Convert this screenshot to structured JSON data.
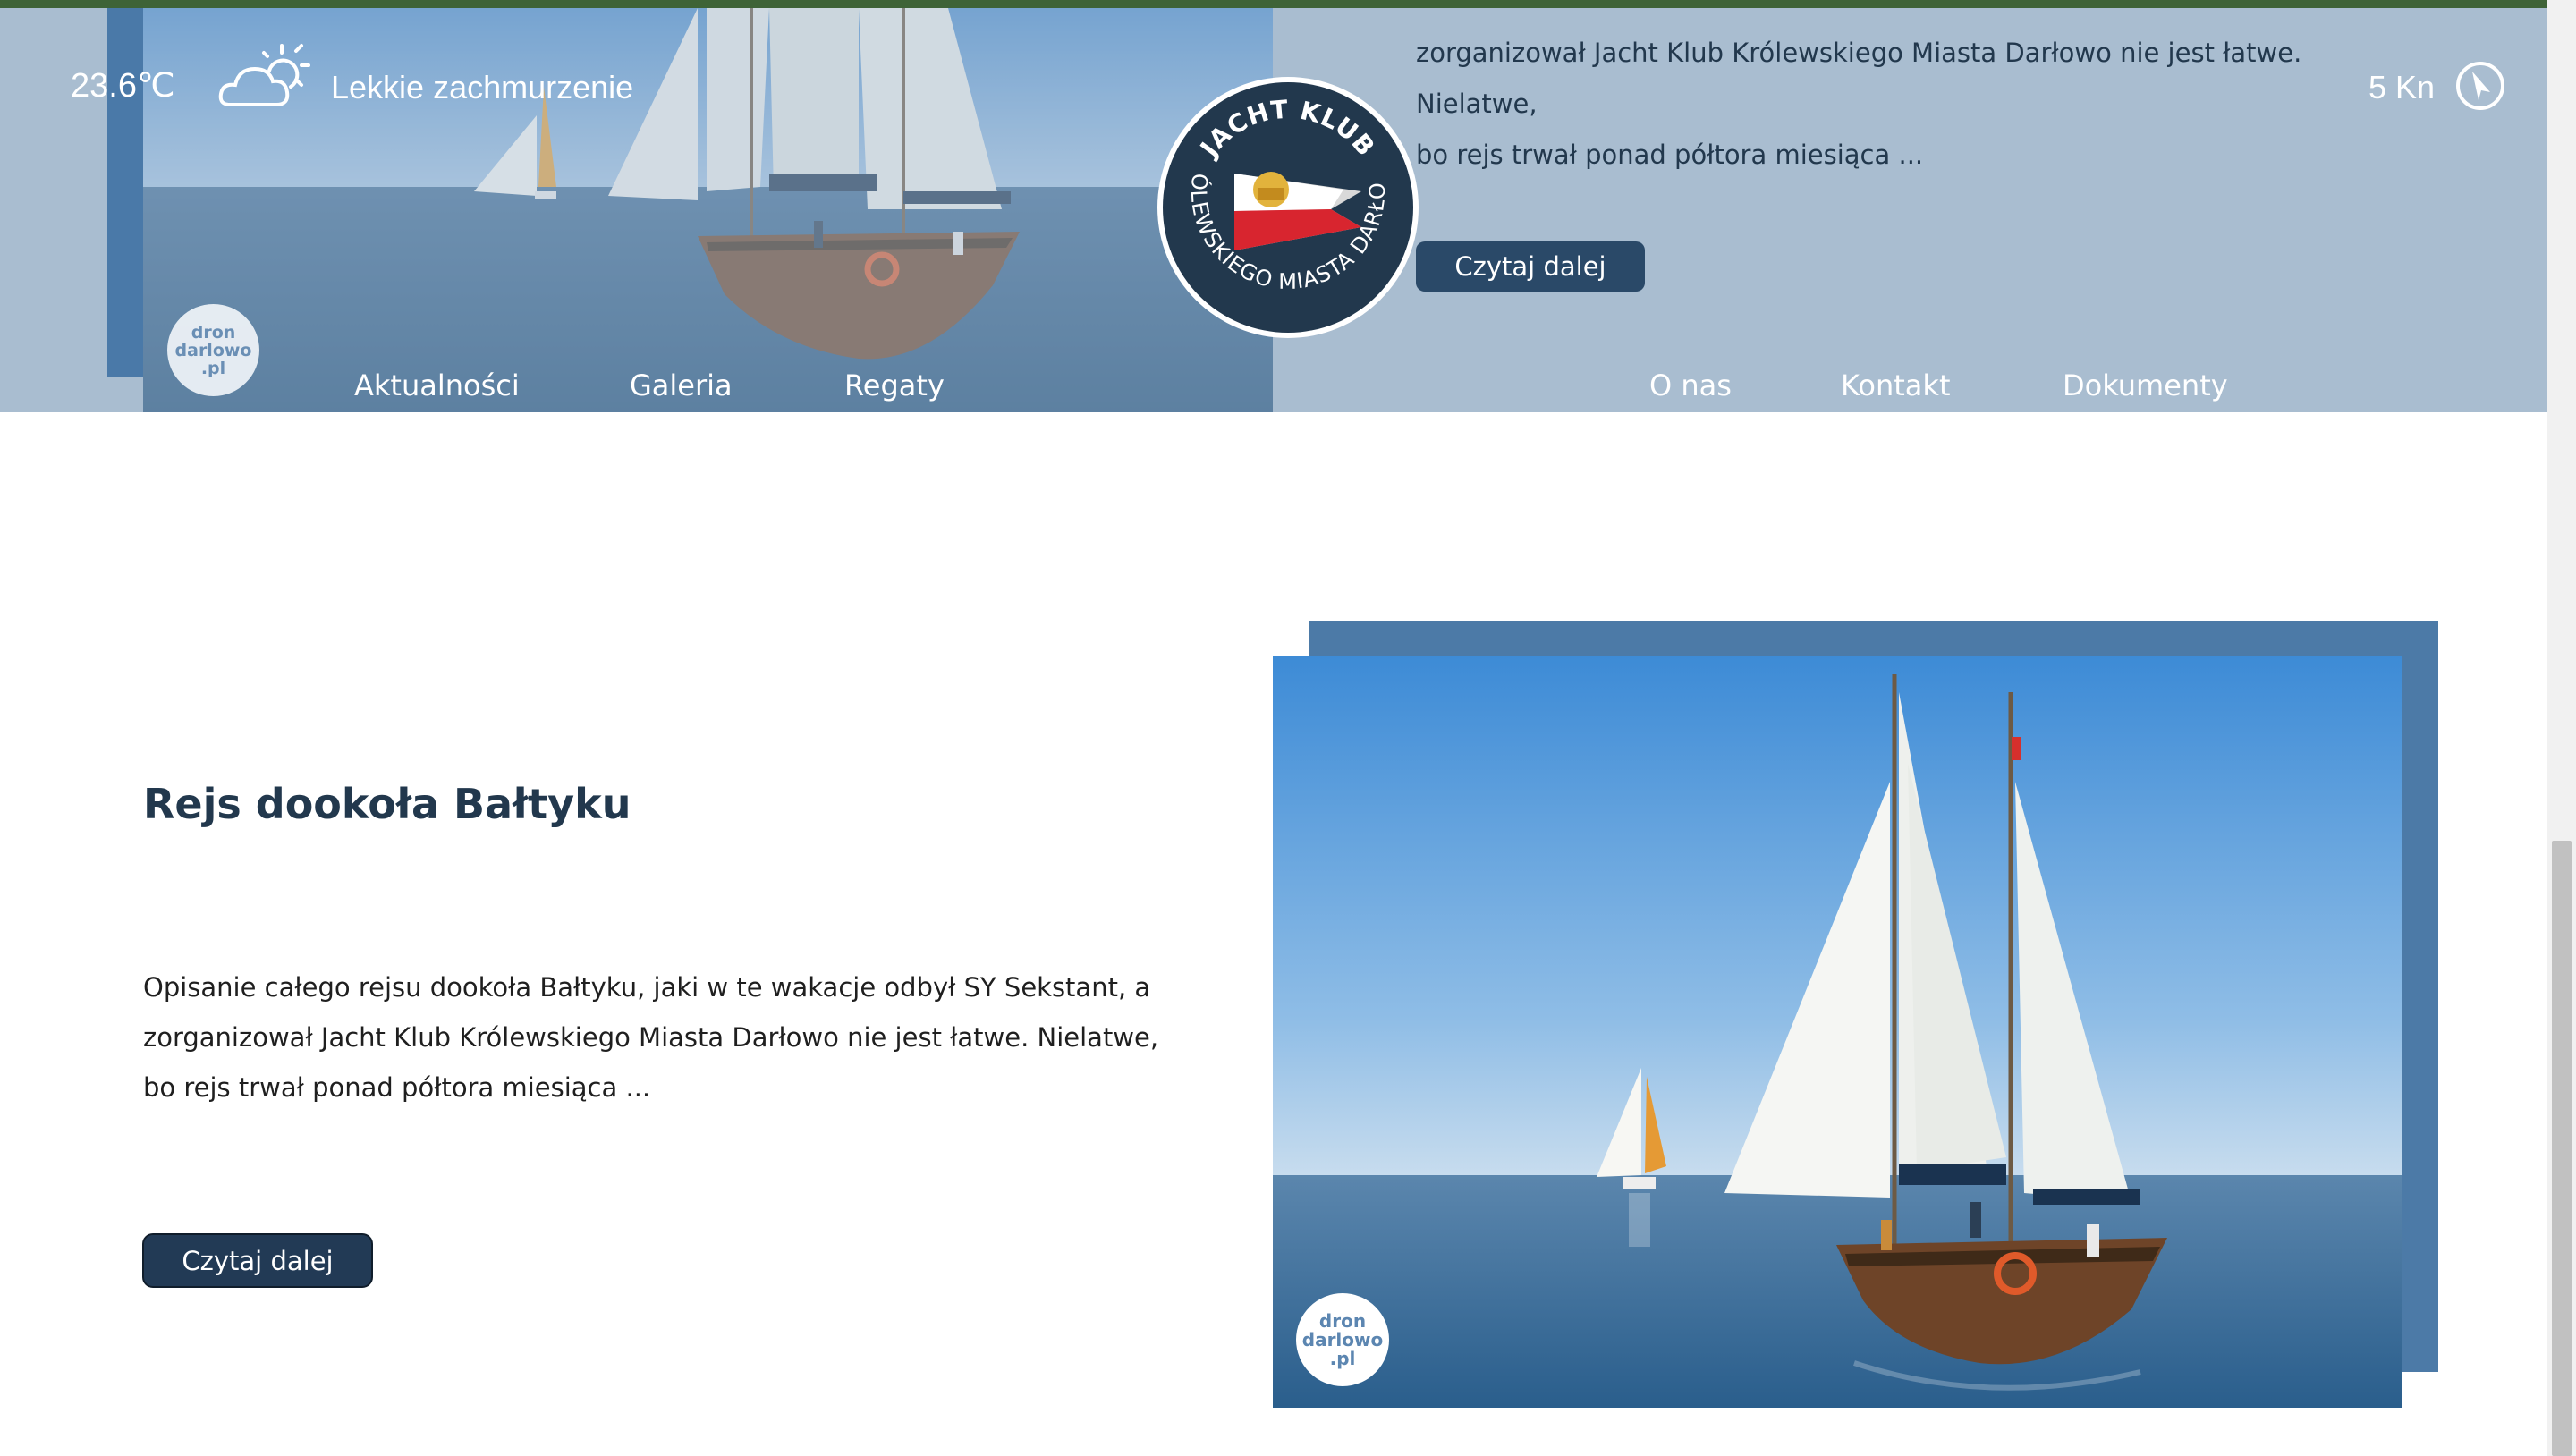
{
  "weather": {
    "temperature": "23.6℃",
    "description": "Lekkie zachmurzenie",
    "icon": "partly-cloudy-icon"
  },
  "wind": {
    "speed": "5 Kn",
    "icon": "wind-direction-icon"
  },
  "header_post": {
    "lines": [
      "zorganizował Jacht Klub Królewskiego Miasta Darłowo nie jest łatwe. Nielatwe,",
      "bo rejs trwał ponad półtora miesiąca ..."
    ],
    "button_label": "Czytaj dalej"
  },
  "logo": {
    "top_text": "JACHT KLUB",
    "ring_text": "KRÓLEWSKIEGO MIASTA DARŁOWO"
  },
  "nav": {
    "left": [
      "Aktualności",
      "Galeria",
      "Regaty"
    ],
    "right": [
      "O nas",
      "Kontakt",
      "Dokumenty"
    ]
  },
  "watermark": {
    "line1": "dron",
    "line2": "darlowo",
    "line3": ".pl"
  },
  "post": {
    "title": "Rejs dookoła Bałtyku",
    "lines": [
      "Opisanie całego rejsu dookoła Bałtyku, jaki w te wakacje odbył SY Sekstant, a",
      "zorganizował Jacht Klub Królewskiego Miasta Darłowo nie jest łatwe. Nielatwe,",
      "bo rejs trwał ponad półtora miesiąca ..."
    ],
    "button_label": "Czytaj dalej"
  },
  "colors": {
    "header_bg": "#a9bdd0",
    "navy": "#22384d",
    "accent_blue": "#4c7aa7",
    "top_line": "#3e6337"
  }
}
